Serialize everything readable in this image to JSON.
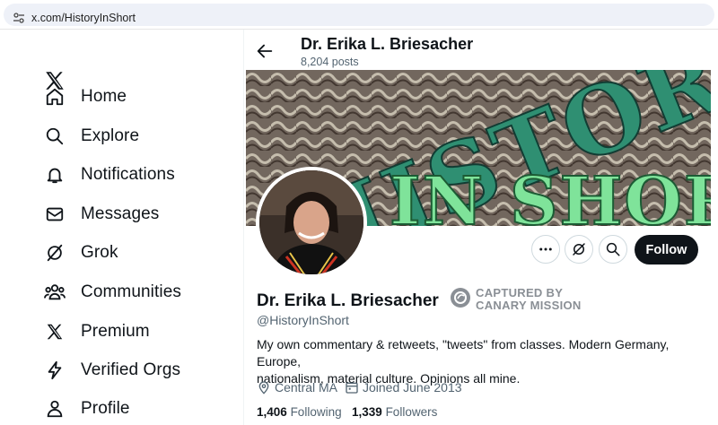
{
  "browser": {
    "url": "x.com/HistoryInShort"
  },
  "nav": {
    "items": [
      {
        "label": "Home"
      },
      {
        "label": "Explore"
      },
      {
        "label": "Notifications"
      },
      {
        "label": "Messages"
      },
      {
        "label": "Grok"
      },
      {
        "label": "Communities"
      },
      {
        "label": "Premium"
      },
      {
        "label": "Verified Orgs"
      },
      {
        "label": "Profile"
      }
    ]
  },
  "header": {
    "name": "Dr. Erika L. Briesacher",
    "posts": "8,204 posts"
  },
  "banner": {
    "line1": "HISTORY",
    "line2": "IN SHORT"
  },
  "actions": {
    "follow": "Follow"
  },
  "profile": {
    "name": "Dr. Erika L. Briesacher",
    "handle": "@HistoryInShort",
    "bio_line1": "My own commentary & retweets, \"tweets\" from classes. Modern Germany, Europe,",
    "bio_line2": "nationalism, material culture. Opinions all mine.",
    "location": "Central MA",
    "joined": "Joined June 2013",
    "following_count": "1,406",
    "following_label": "Following",
    "followers_count": "1,339",
    "followers_label": "Followers"
  },
  "overlay": {
    "line1": "CAPTURED BY",
    "line2": "CANARY MISSION"
  },
  "colors": {
    "text": "#0f1419",
    "muted": "#536471",
    "banner_teal": "#2f8f72",
    "banner_green": "#7fe39a"
  }
}
